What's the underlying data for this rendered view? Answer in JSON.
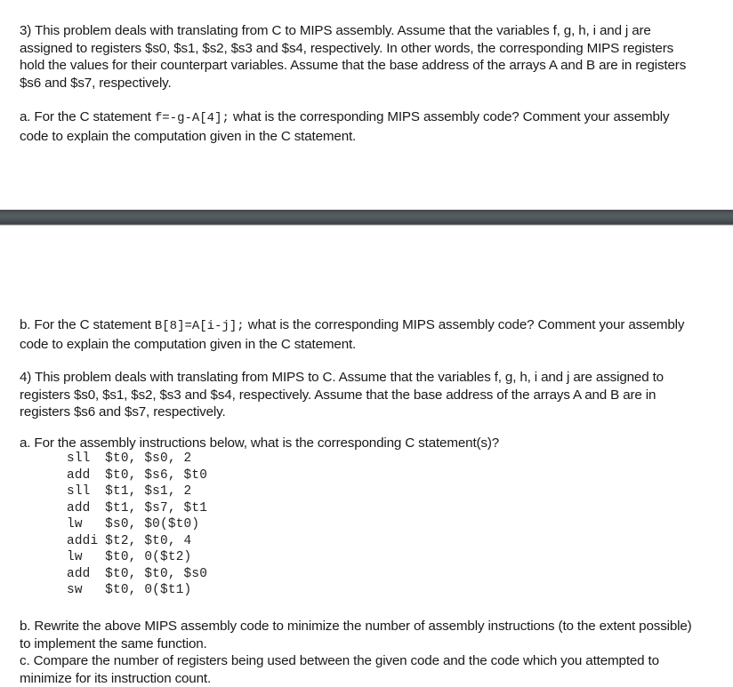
{
  "document": {
    "title": "MIPS Assembly Problem Set",
    "background_color": "#ffffff",
    "text_color": "#181818"
  },
  "divider": {
    "color": "#474d51",
    "highlight_color": "#565d61"
  },
  "problem3": {
    "intro": "3) This problem deals with translating from C to MIPS assembly.  Assume that the variables f, g, h, i and j are assigned to registers $s0, $s1, $s2, $s3 and $s4, respectively.  In other words, the corresponding MIPS registers hold the values for their counterpart variables.  Assume that the base address of the arrays A and B are in registers $s6 and $s7, respectively.",
    "part_a": {
      "lead": "a. For the C statement ",
      "code": "f=-g-A[4];",
      "tail": " what is the corresponding MIPS assembly code?  Comment your assembly code to explain the computation given in the C statement."
    },
    "part_b": {
      "lead": "b. For the C statement ",
      "code": "B[8]=A[i-j];",
      "tail": " what is the corresponding MIPS assembly code?  Comment your assembly code to explain the computation given in the C statement."
    }
  },
  "problem4": {
    "intro": "4) This problem deals with translating from MIPS to C.  Assume that the variables f, g, h, i and j are assigned to registers $s0, $s1, $s2, $s3 and $s4, respectively.  Assume that the base address of the arrays A and B are in registers $s6 and $s7, respectively.",
    "part_a": {
      "question": "a. For the assembly instructions below, what is the corresponding C statement(s)?",
      "assembly": [
        {
          "op": "sll",
          "operands": "$t0, $s0, 2"
        },
        {
          "op": "add",
          "operands": "$t0, $s6, $t0"
        },
        {
          "op": "sll",
          "operands": "$t1, $s1, 2"
        },
        {
          "op": "add",
          "operands": "$t1, $s7, $t1"
        },
        {
          "op": "lw",
          "operands": "$s0, $0($t0)"
        },
        {
          "op": "addi",
          "operands": "$t2, $t0, 4"
        },
        {
          "op": "lw",
          "operands": "$t0, 0($t2)"
        },
        {
          "op": "add",
          "operands": "$t0, $t0, $s0"
        },
        {
          "op": "sw",
          "operands": "$t0, 0($t1)"
        }
      ]
    },
    "part_b": "b. Rewrite the above MIPS assembly code to minimize the number of assembly instructions (to the extent possible) to implement the same function.",
    "part_c": "c. Compare the number of registers being used between the given code and the code which you attempted to minimize for its instruction count."
  }
}
